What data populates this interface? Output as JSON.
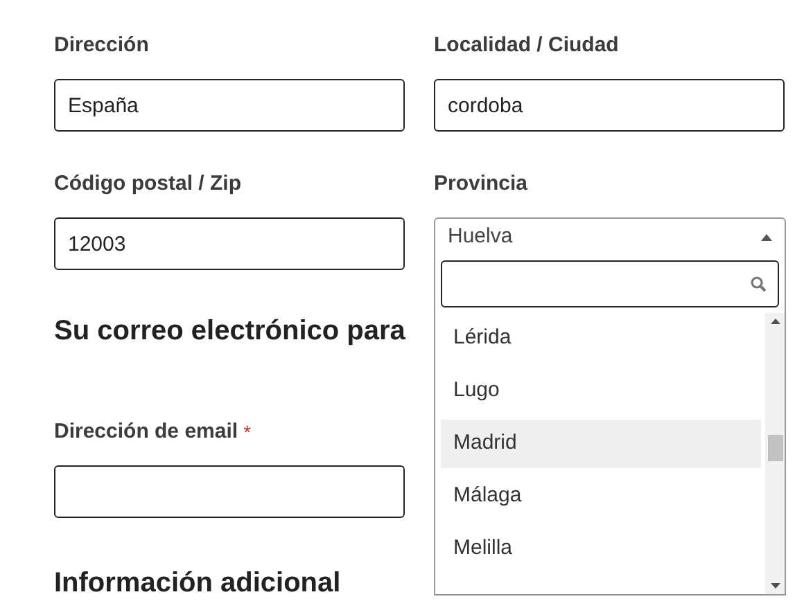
{
  "address_fields": [
    {
      "label": "Dirección",
      "value": "España"
    },
    {
      "label": "Localidad / Ciudad",
      "value": "cordoba"
    },
    {
      "label": "Código postal / Zip",
      "value": "12003"
    }
  ],
  "province": {
    "label": "Provincia",
    "value": "Huelva",
    "expanded": true,
    "options": [
      {
        "label": "Lérida",
        "selected": false
      },
      {
        "label": "Lugo",
        "selected": false
      },
      {
        "label": "Madrid",
        "selected": true
      },
      {
        "label": "Málaga",
        "selected": false
      },
      {
        "label": "Melilla",
        "selected": false
      }
    ]
  },
  "email_section": {
    "heading": "Su correo electrónico para",
    "label": "Dirección de email",
    "required_mark": "*"
  },
  "additional_section": {
    "heading": "Información adicional"
  }
}
